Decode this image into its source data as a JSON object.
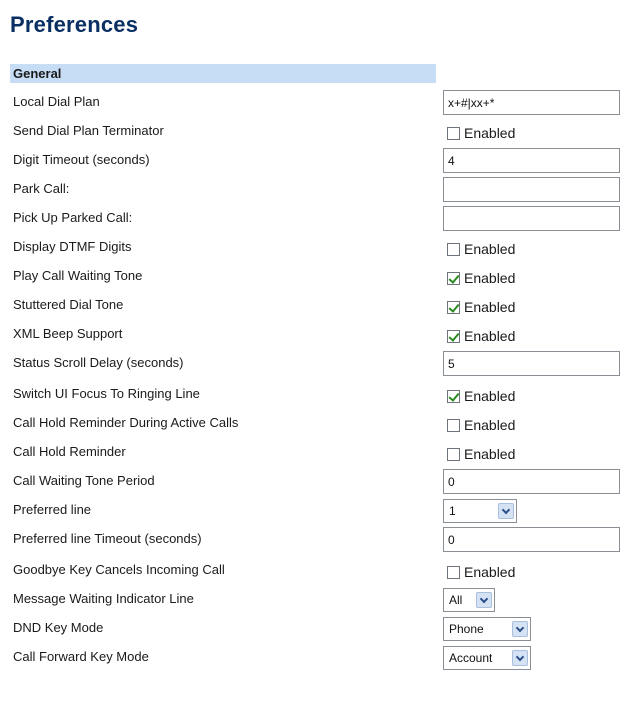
{
  "page": {
    "title": "Preferences"
  },
  "section": {
    "title": "General"
  },
  "rows": {
    "local_dial_plan": {
      "label": "Local Dial Plan",
      "value": "x+#|xx+*"
    },
    "send_dial_plan_terminator": {
      "label": "Send Dial Plan Terminator",
      "checked": false,
      "check_label": "Enabled"
    },
    "digit_timeout": {
      "label": "Digit Timeout (seconds)",
      "value": "4"
    },
    "park_call": {
      "label": "Park Call:",
      "value": ""
    },
    "pick_up_parked_call": {
      "label": "Pick Up Parked Call:",
      "value": ""
    },
    "display_dtmf_digits": {
      "label": "Display DTMF Digits",
      "checked": false,
      "check_label": "Enabled"
    },
    "play_call_waiting_tone": {
      "label": "Play Call Waiting Tone",
      "checked": true,
      "check_label": "Enabled"
    },
    "stuttered_dial_tone": {
      "label": "Stuttered Dial Tone",
      "checked": true,
      "check_label": "Enabled"
    },
    "xml_beep_support": {
      "label": "XML Beep Support",
      "checked": true,
      "check_label": "Enabled"
    },
    "status_scroll_delay": {
      "label": "Status Scroll Delay (seconds)",
      "value": "5"
    },
    "switch_ui_focus": {
      "label": "Switch UI Focus To Ringing Line",
      "checked": true,
      "check_label": "Enabled"
    },
    "call_hold_reminder_active": {
      "label": "Call Hold Reminder During Active Calls",
      "checked": false,
      "check_label": "Enabled"
    },
    "call_hold_reminder": {
      "label": "Call Hold Reminder",
      "checked": false,
      "check_label": "Enabled"
    },
    "call_waiting_tone_period": {
      "label": "Call Waiting Tone Period",
      "value": "0"
    },
    "preferred_line": {
      "label": "Preferred line",
      "selected": "1"
    },
    "preferred_line_timeout": {
      "label": "Preferred line Timeout (seconds)",
      "value": "0"
    },
    "goodbye_key_cancels": {
      "label": "Goodbye Key Cancels Incoming Call",
      "checked": false,
      "check_label": "Enabled"
    },
    "mwi_line": {
      "label": "Message Waiting Indicator Line",
      "selected": "All"
    },
    "dnd_key_mode": {
      "label": "DND Key Mode",
      "selected": "Phone"
    },
    "call_forward_key_mode": {
      "label": "Call Forward Key Mode",
      "selected": "Account"
    }
  },
  "icons": {
    "dropdown_arrow": "chevron-down-icon",
    "checkmark": "checkmark-icon"
  },
  "colors": {
    "title": "#0a2f63",
    "section_header_bg": "#c6ddf5",
    "checkmark": "#2a8a1f",
    "dropdown_button": "#d5e2f3"
  }
}
